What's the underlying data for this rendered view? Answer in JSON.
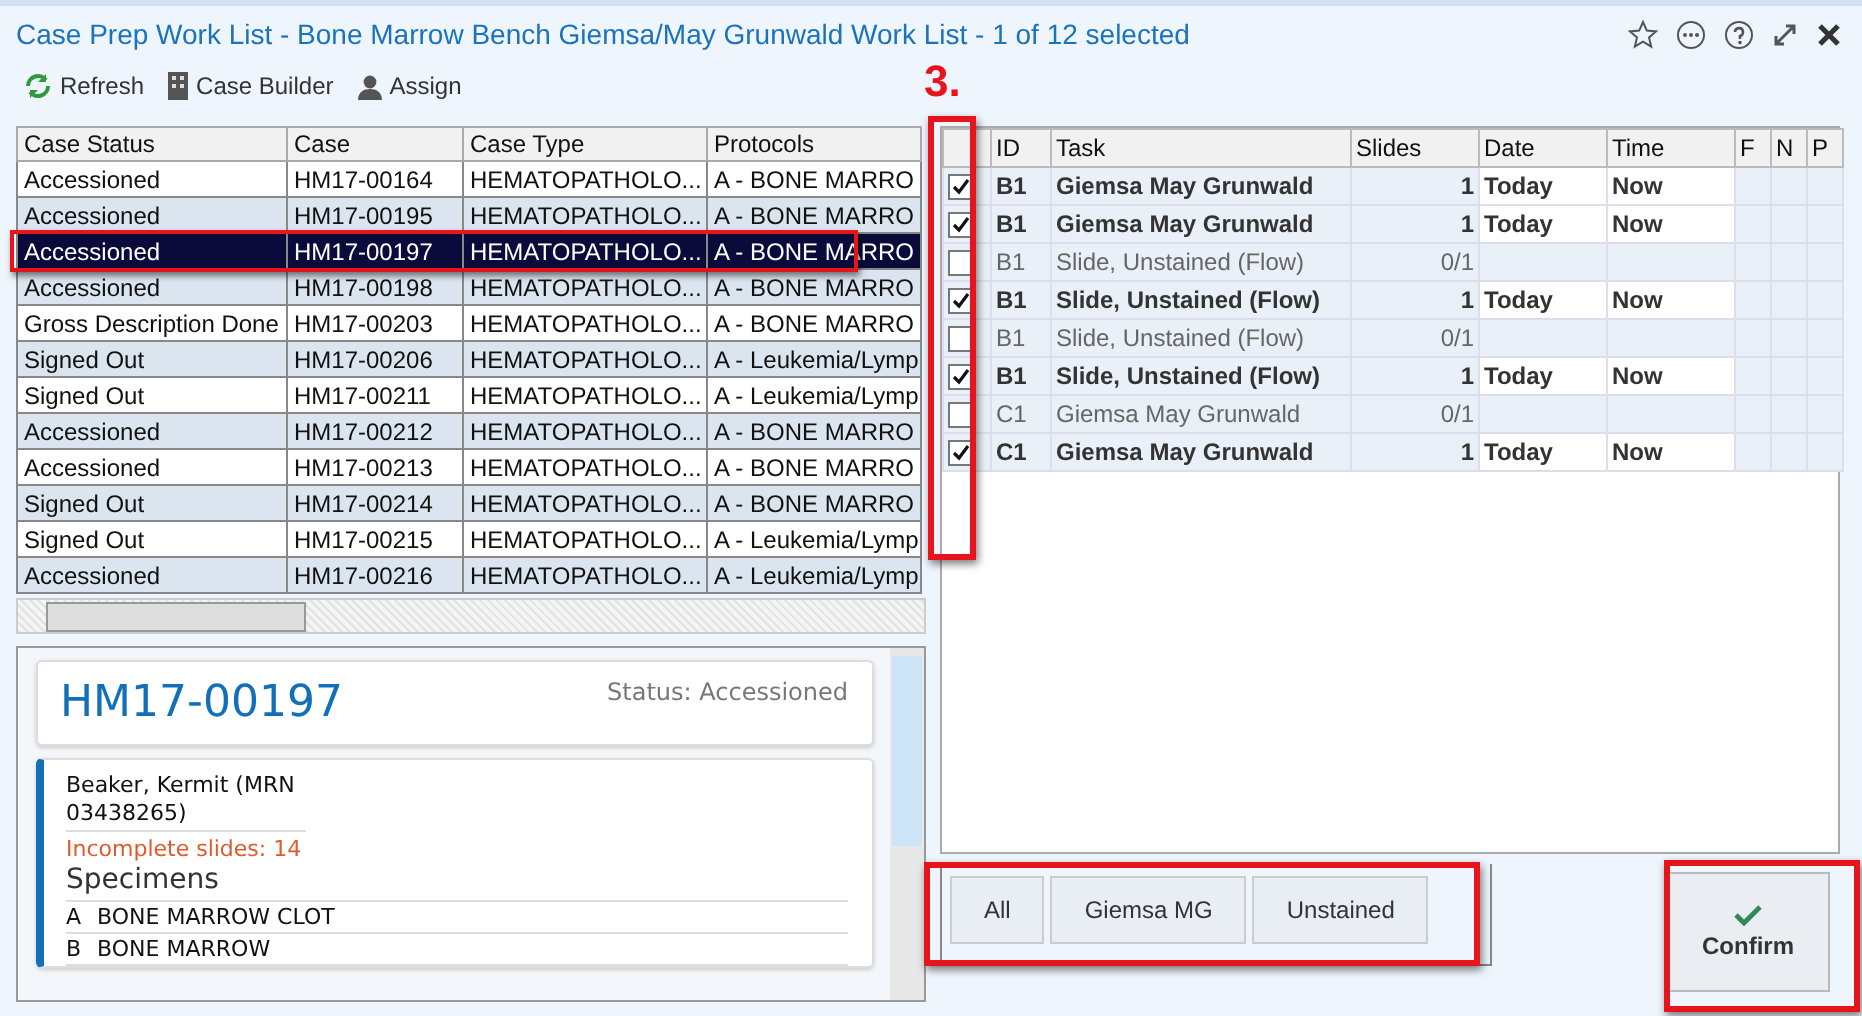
{
  "window": {
    "title": "Case Prep Work List - Bone Marrow Bench Giemsa/May Grunwald Work List - 1 of 12 selected"
  },
  "toolbar": [
    {
      "label": "Refresh",
      "kind": "refresh"
    },
    {
      "label": "Case Builder",
      "kind": "builder"
    },
    {
      "label": "Assign",
      "kind": "assign"
    }
  ],
  "annotation": {
    "label": "3."
  },
  "case_list": {
    "columns": [
      "Case Status",
      "Case",
      "Case Type",
      "Protocols"
    ],
    "rows": [
      {
        "cells": [
          "Accessioned",
          "HM17-00164",
          "HEMATOPATHOLO...",
          "A - BONE MARRO"
        ],
        "selected": false,
        "highlighted": false
      },
      {
        "cells": [
          "Accessioned",
          "HM17-00195",
          "HEMATOPATHOLO...",
          "A - BONE MARRO"
        ],
        "selected": false,
        "highlighted": false
      },
      {
        "cells": [
          "Accessioned",
          "HM17-00197",
          "HEMATOPATHOLO...",
          "A - BONE MARRO"
        ],
        "selected": true,
        "highlighted": true
      },
      {
        "cells": [
          "Accessioned",
          "HM17-00198",
          "HEMATOPATHOLO...",
          "A - BONE MARRO"
        ],
        "selected": false,
        "highlighted": false
      },
      {
        "cells": [
          "Gross Description Done",
          "HM17-00203",
          "HEMATOPATHOLO...",
          "A - BONE MARRO"
        ],
        "selected": false,
        "highlighted": false
      },
      {
        "cells": [
          "Signed Out",
          "HM17-00206",
          "HEMATOPATHOLO...",
          "A - Leukemia/Lymp"
        ],
        "selected": false,
        "highlighted": false
      },
      {
        "cells": [
          "Signed Out",
          "HM17-00211",
          "HEMATOPATHOLO...",
          "A - Leukemia/Lymp"
        ],
        "selected": false,
        "highlighted": false
      },
      {
        "cells": [
          "Accessioned",
          "HM17-00212",
          "HEMATOPATHOLO...",
          "A - BONE MARRO"
        ],
        "selected": false,
        "highlighted": false
      },
      {
        "cells": [
          "Accessioned",
          "HM17-00213",
          "HEMATOPATHOLO...",
          "A - BONE MARRO"
        ],
        "selected": false,
        "highlighted": false
      },
      {
        "cells": [
          "Signed Out",
          "HM17-00214",
          "HEMATOPATHOLO...",
          "A - BONE MARRO"
        ],
        "selected": false,
        "highlighted": false
      },
      {
        "cells": [
          "Signed Out",
          "HM17-00215",
          "HEMATOPATHOLO...",
          "A - Leukemia/Lymp"
        ],
        "selected": false,
        "highlighted": false
      },
      {
        "cells": [
          "Accessioned",
          "HM17-00216",
          "HEMATOPATHOLO...",
          "A - Leukemia/Lymp"
        ],
        "selected": false,
        "highlighted": false
      }
    ]
  },
  "case_detail": {
    "case_number": "HM17-00197",
    "status": "Status: Accessioned",
    "patient": "Beaker, Kermit (MRN 03438265)",
    "incomplete": "Incomplete slides: 14",
    "specimens_heading": "Specimens",
    "specimens": [
      {
        "letter": "A",
        "name": "BONE MARROW CLOT"
      },
      {
        "letter": "B",
        "name": "BONE MARROW"
      }
    ]
  },
  "task_table": {
    "checkbox_column_highlighted": true,
    "columns": [
      "ID",
      "Task",
      "Slides",
      "Date",
      "Time",
      "F",
      "N",
      "P"
    ],
    "rows": [
      {
        "checked": true,
        "id": "B1",
        "task": "Giemsa May Grunwald",
        "slides": "1",
        "date": "Today",
        "time": "Now"
      },
      {
        "checked": true,
        "id": "B1",
        "task": "Giemsa May Grunwald",
        "slides": "1",
        "date": "Today",
        "time": "Now"
      },
      {
        "checked": false,
        "id": "B1",
        "task": "Slide, Unstained (Flow)",
        "slides": "0/1"
      },
      {
        "checked": true,
        "id": "B1",
        "task": "Slide, Unstained (Flow)",
        "slides": "1",
        "date": "Today",
        "time": "Now"
      },
      {
        "checked": false,
        "id": "B1",
        "task": "Slide, Unstained (Flow)",
        "slides": "0/1"
      },
      {
        "checked": true,
        "id": "B1",
        "task": "Slide, Unstained (Flow)",
        "slides": "1",
        "date": "Today",
        "time": "Now"
      },
      {
        "checked": false,
        "id": "C1",
        "task": "Giemsa May Grunwald",
        "slides": "0/1"
      },
      {
        "checked": true,
        "id": "C1",
        "task": "Giemsa May Grunwald",
        "slides": "1",
        "date": "Today",
        "time": "Now"
      }
    ]
  },
  "filter_buttons": {
    "highlighted": true,
    "items": [
      "All",
      "Giemsa MG",
      "Unstained"
    ]
  },
  "confirm": {
    "label": "Confirm",
    "highlighted": true
  }
}
